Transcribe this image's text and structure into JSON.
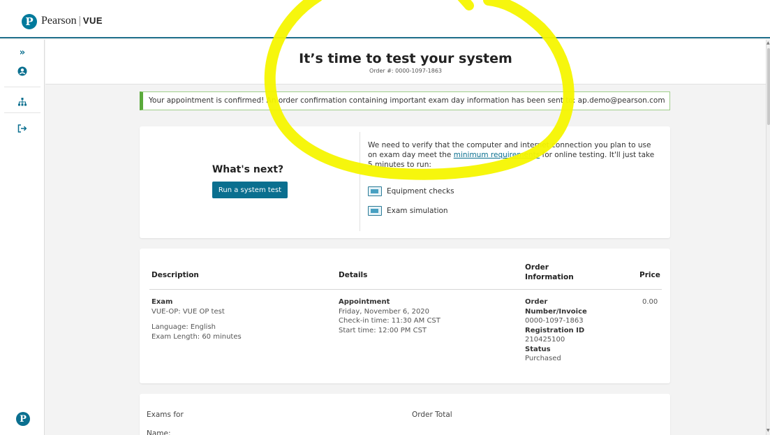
{
  "header": {
    "logo_letter": "P",
    "brand_name": "Pearson",
    "brand_separator": "|",
    "brand_product": "VUE"
  },
  "sidebar": {
    "icons": [
      "expand-icon",
      "user-icon",
      "sitemap-icon",
      "sign-out-icon"
    ],
    "expand_glyph": "»",
    "logo_letter": "P"
  },
  "page": {
    "title": "It’s time to test your system",
    "order_number": "Order #: 0000-1097-1863"
  },
  "banner": {
    "text": "Your appointment is confirmed! An order confirmation containing important exam day information has been sent to: ap.demo@pearson.com"
  },
  "next_steps": {
    "heading": "What's next?",
    "button_label": "Run a system test",
    "verify_text_before": "We need to verify that the computer and internet connection you plan to use on exam day meet the ",
    "verify_link": "minimum requirements",
    "verify_text_after": " for online testing. It'll just take 5 minutes to run:",
    "checks": [
      "Equipment checks",
      "Exam simulation"
    ]
  },
  "order_table": {
    "headers": {
      "description": "Description",
      "details": "Details",
      "order_info_1": "Order",
      "order_info_2": "Information",
      "price": "Price"
    },
    "row": {
      "desc_title": "Exam",
      "desc_name": "VUE-OP: VUE OP test",
      "desc_language": "Language: English",
      "desc_length": "Exam Length: 60 minutes",
      "details_title": "Appointment",
      "details_date": "Friday, November 6, 2020",
      "details_checkin": "Check-in time: 11:30 AM CST",
      "details_start": "Start time: 12:00 PM CST",
      "order_label_1": "Order",
      "order_label_2": "Number/Invoice",
      "order_number": "0000-1097-1863",
      "reg_label": "Registration ID",
      "reg_id": "210425100",
      "status_label": "Status",
      "status_value": "Purchased",
      "price": "0.00"
    }
  },
  "summary": {
    "exams_for": "Exams for",
    "name_label": "Name:",
    "order_total": "Order Total"
  },
  "colors": {
    "brand_teal": "#0a6f8f",
    "banner_green": "#5aaa3a",
    "highlight_yellow": "#f5f500"
  }
}
